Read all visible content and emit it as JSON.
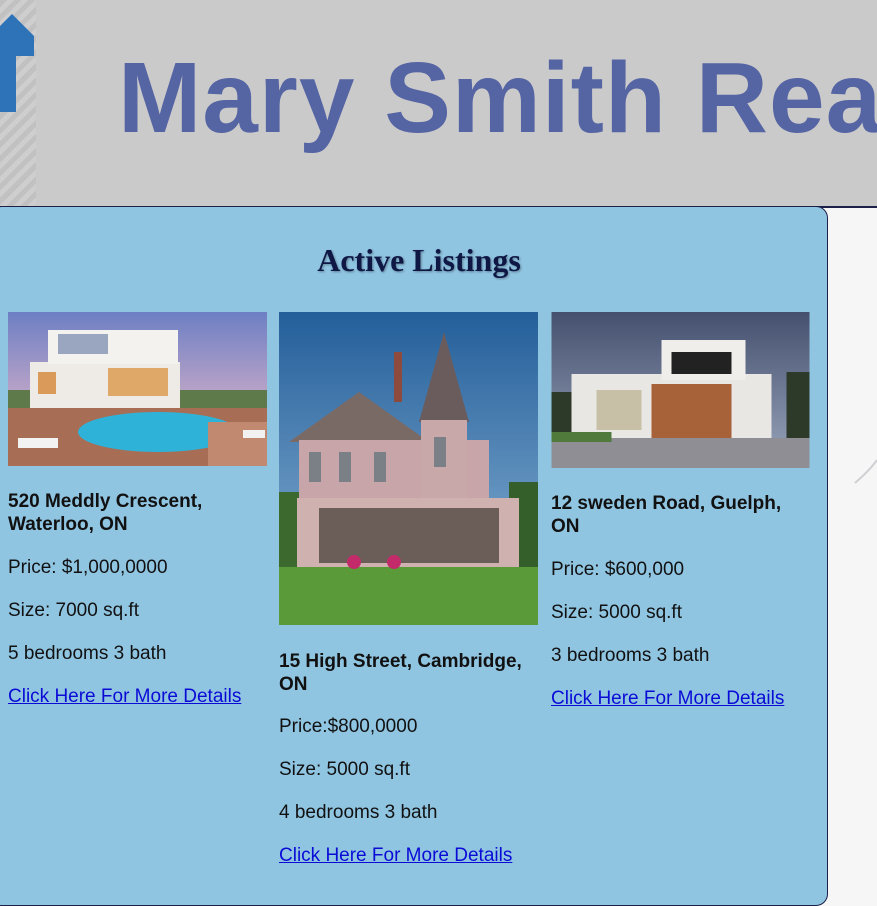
{
  "header": {
    "title": "Mary Smith Real",
    "logo_icon": "house-arrow-icon"
  },
  "main": {
    "heading": "Active Listings",
    "listings": [
      {
        "address": "520 Meddly Crescent, Waterloo, ON",
        "price": "Price: $1,000,0000",
        "size": "Size: 7000 sq.ft",
        "rooms": "5 bedrooms 3 bath",
        "link": "Click Here For More Details",
        "image": "modern-villa-with-pool"
      },
      {
        "address": "15 High Street, Cambridge, ON",
        "price": "Price:$800,0000",
        "size": "Size: 5000 sq.ft",
        "rooms": "4 bedrooms 3 bath",
        "link": "Click Here For More Details",
        "image": "victorian-house"
      },
      {
        "address": "12 sweden Road, Guelph, ON",
        "price": "Price: $600,000",
        "size": "Size: 5000 sq.ft",
        "rooms": "3 bedrooms 3 bath",
        "link": "Click Here For More Details",
        "image": "contemporary-house"
      }
    ]
  },
  "colors": {
    "header_bg": "#cbcacb",
    "title": "#5564a3",
    "panel_bg": "#90c5e2",
    "link": "#0b0bd6"
  }
}
